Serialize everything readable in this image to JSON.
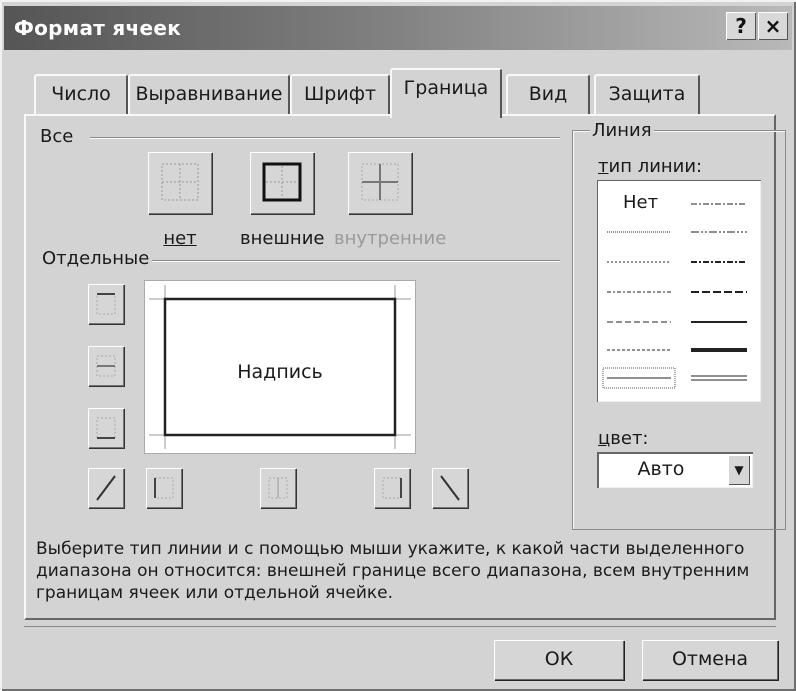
{
  "window": {
    "title": "Формат ячеек",
    "help_button": "?",
    "close_button": "×"
  },
  "tabs": [
    {
      "label": "Число",
      "active": false
    },
    {
      "label": "Выравнивание",
      "active": false
    },
    {
      "label": "Шрифт",
      "active": false
    },
    {
      "label": "Граница",
      "active": true
    },
    {
      "label": "Вид",
      "active": false
    },
    {
      "label": "Защита",
      "active": false
    }
  ],
  "presets": {
    "group_label": "Все",
    "none": "нет",
    "outline": "внешние",
    "inside": "внутренние"
  },
  "border": {
    "group_label": "Отдельные",
    "preview_text": "Надпись"
  },
  "line": {
    "group_label": "Линия",
    "style_label": "тип линии:",
    "none_label": "Нет",
    "color_label": "цвет:",
    "color_value": "Авто"
  },
  "help_text": "Выберите тип линии и с помощью мыши укажите, к какой части выделенного диапазона он относится: внешней границе всего диапазона, всем внутренним границам ячеек или отдельной ячейке.",
  "buttons": {
    "ok": "ОК",
    "cancel": "Отмена"
  },
  "colors": {
    "dialog_bg": "#d3d3d3",
    "titlebar_start": "#555555",
    "titlebar_end": "#b9b9b9"
  }
}
